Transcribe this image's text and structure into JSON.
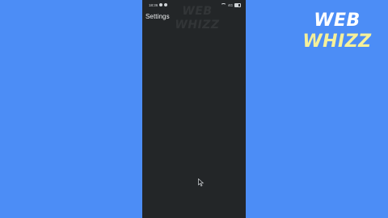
{
  "status_bar": {
    "time": "18:36",
    "right_text": "4G"
  },
  "screen": {
    "title": "Settings"
  },
  "watermark": {
    "line1": "WEB",
    "line2": "WHIZZ"
  },
  "logo": {
    "line1": "WEB",
    "line2": "WHIZZ",
    "colors": {
      "line1": "#ffffff",
      "line2": "#f5f09a"
    }
  },
  "colors": {
    "background": "#4c8df6",
    "phone_screen": "#232628"
  },
  "icons": {
    "pointer": "mouse-pointer-icon",
    "edge_handle": "side-panel-handle-icon"
  }
}
